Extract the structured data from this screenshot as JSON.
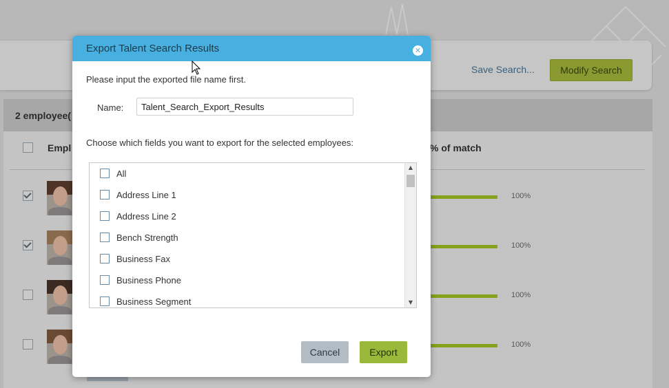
{
  "background": {
    "search_bar": {
      "save_search_label": "Save Search...",
      "modify_search_label": "Modify Search"
    },
    "results": {
      "count_label": "2 employee(",
      "column_employee": "Empl",
      "column_match": "% of match",
      "rows": [
        {
          "checked": true,
          "match_pct": "100%",
          "match_value": 1.0
        },
        {
          "checked": true,
          "match_pct": "100%",
          "match_value": 1.0
        },
        {
          "checked": false,
          "match_pct": "100%",
          "match_value": 1.0
        },
        {
          "checked": false,
          "match_pct": "100%",
          "match_value": 1.0
        }
      ]
    }
  },
  "dialog": {
    "title": "Export Talent Search Results",
    "close_icon": "close-icon",
    "instruction": "Please input the exported file name first.",
    "name_label": "Name:",
    "name_value": "Talent_Search_Export_Results",
    "fields_instruction": "Choose which fields you want to export for the selected employees:",
    "fields": [
      {
        "label": "All",
        "checked": false
      },
      {
        "label": "Address Line 1",
        "checked": false
      },
      {
        "label": "Address Line 2",
        "checked": false
      },
      {
        "label": "Bench Strength",
        "checked": false
      },
      {
        "label": "Business Fax",
        "checked": false
      },
      {
        "label": "Business Phone",
        "checked": false
      },
      {
        "label": "Business Segment",
        "checked": false
      }
    ],
    "cancel_label": "Cancel",
    "export_label": "Export"
  },
  "colors": {
    "header_blue": "#47b0e0",
    "export_green": "#9ab83a",
    "match_bar_green": "#86a21a"
  }
}
